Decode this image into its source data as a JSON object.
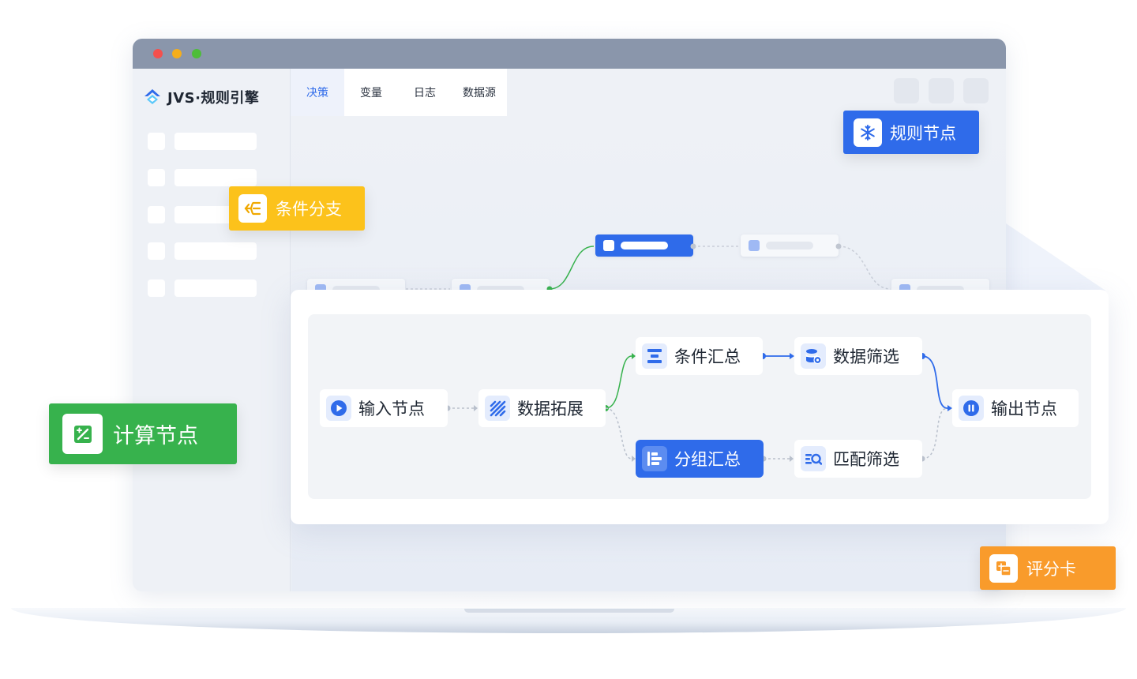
{
  "app": {
    "brand": "JVS·规则引擎",
    "colors": {
      "accent": "#2f6bea",
      "green": "#37b24d",
      "yellow": "#fcc21b",
      "orange": "#f99b2b"
    }
  },
  "window_controls": [
    "close",
    "minimize",
    "maximize"
  ],
  "tabs": [
    {
      "label": "决策",
      "active": true
    },
    {
      "label": "变量",
      "active": false
    },
    {
      "label": "日志",
      "active": false
    },
    {
      "label": "数据源",
      "active": false
    }
  ],
  "flow": {
    "nodes": {
      "input": {
        "label": "输入节点",
        "icon": "play-circle-icon"
      },
      "expand": {
        "label": "数据拓展",
        "icon": "data-expand-icon"
      },
      "cond_sum": {
        "label": "条件汇总",
        "icon": "condition-summary-icon"
      },
      "filter": {
        "label": "数据筛选",
        "icon": "database-filter-icon"
      },
      "group_sum": {
        "label": "分组汇总",
        "icon": "group-summary-icon",
        "active": true
      },
      "match": {
        "label": "匹配筛选",
        "icon": "match-search-icon"
      },
      "output": {
        "label": "输出节点",
        "icon": "pause-circle-icon"
      }
    }
  },
  "floating_tags": {
    "rule": {
      "label": "规则节点",
      "icon": "snowflake-icon",
      "color": "#2f6bea"
    },
    "branch": {
      "label": "条件分支",
      "icon": "branch-icon",
      "color": "#fcc21b"
    },
    "calc": {
      "label": "计算节点",
      "icon": "calculator-icon",
      "color": "#37b24d"
    },
    "score": {
      "label": "评分卡",
      "icon": "scorecard-icon",
      "color": "#f99b2b"
    }
  }
}
